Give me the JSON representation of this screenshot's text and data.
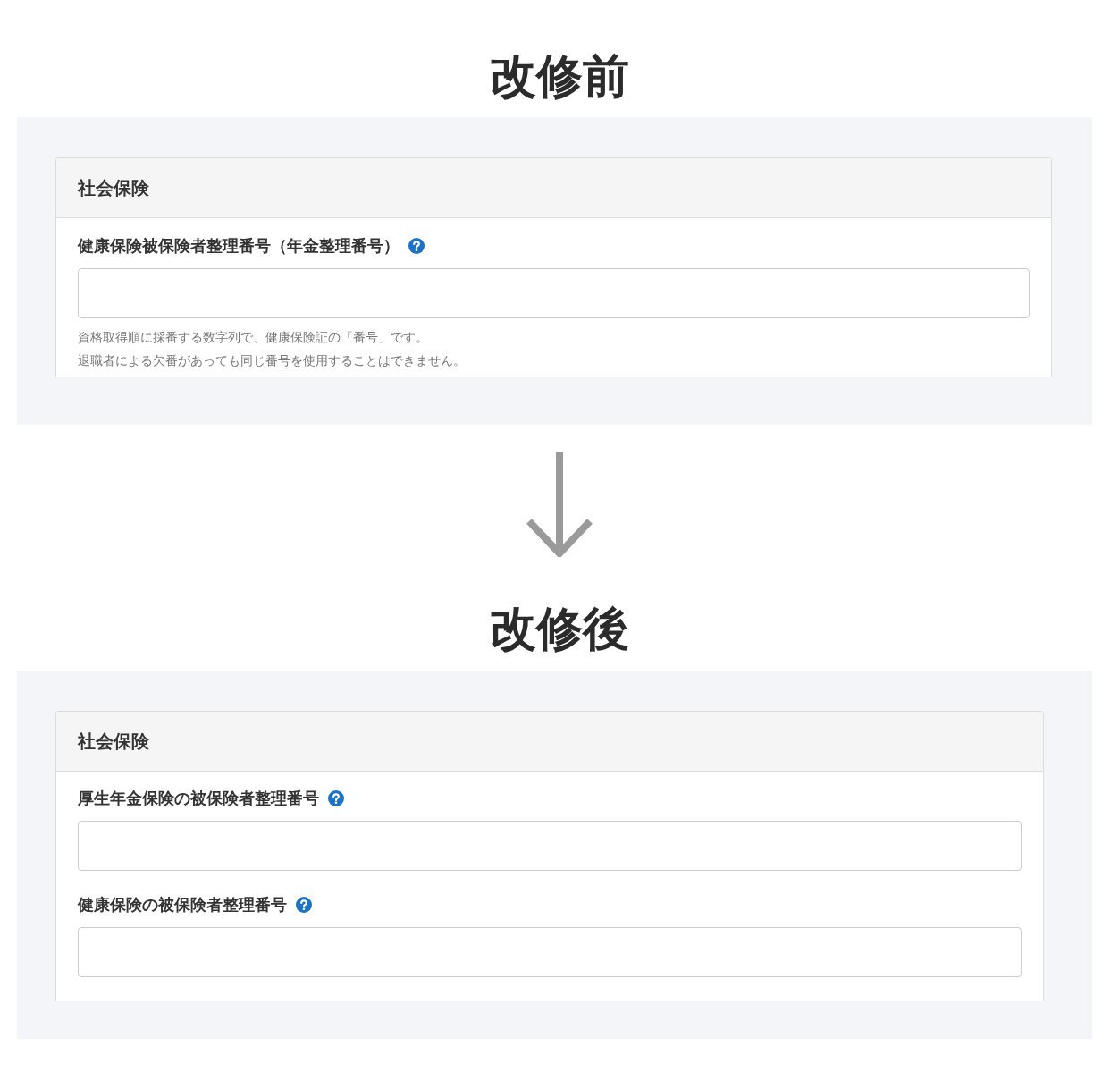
{
  "sections": [
    {
      "heading": "改修前",
      "panel": {
        "title": "社会保険",
        "fields": [
          {
            "label": "健康保険被保険者整理番号（年金整理番号）",
            "help": true,
            "hint_lines": [
              "資格取得順に採番する数字列で、健康保険証の「番号」です。",
              "退職者による欠番があっても同じ番号を使用することはできません。"
            ]
          }
        ]
      }
    },
    {
      "heading": "改修後",
      "panel": {
        "title": "社会保険",
        "fields": [
          {
            "label": "厚生年金保険の被保険者整理番号",
            "help": true
          },
          {
            "label": "健康保険の被保険者整理番号",
            "help": true
          }
        ]
      }
    }
  ]
}
